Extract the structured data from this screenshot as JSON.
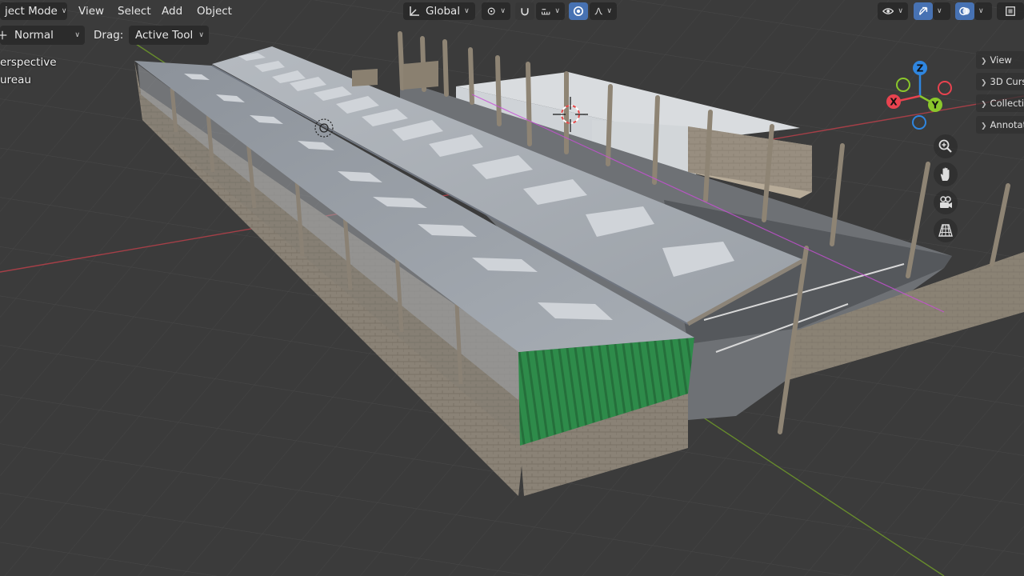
{
  "header": {
    "mode_label": "ject Mode",
    "menus": {
      "view": "View",
      "select": "Select",
      "add": "Add",
      "object": "Object"
    },
    "transform_orientation": "Global"
  },
  "tool_settings": {
    "orient_value": "Normal",
    "drag_label": "Drag:",
    "drag_value": "Active Tool"
  },
  "viewport_info": {
    "line1": "erspective",
    "line2": "ureau"
  },
  "sidebar_tabs": [
    "View",
    "3D Curs",
    "Collecti",
    "Annotati"
  ],
  "gizmo": {
    "z": "Z",
    "x": "X",
    "y": "Y"
  },
  "icons": {
    "zoom": "zoom-icon",
    "pan": "hand-icon",
    "camera": "camera-icon",
    "projection": "grid-icon"
  },
  "colors": {
    "accent": "#4772b3",
    "axis_x": "#e8434f",
    "axis_y": "#8bc72b",
    "axis_z": "#2f86e0",
    "roof_cladding": "#2e8b4a"
  }
}
